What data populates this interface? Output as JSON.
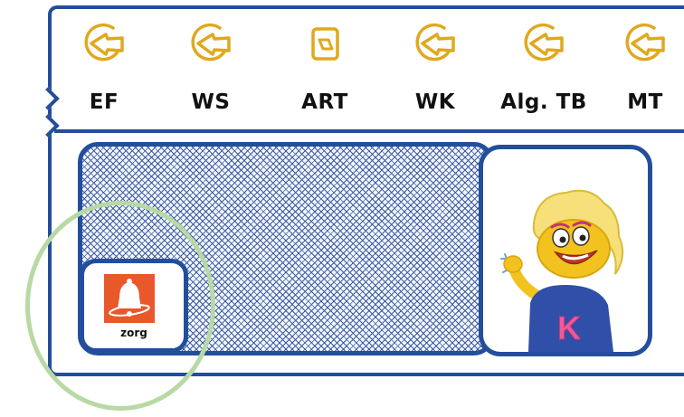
{
  "colors": {
    "frame": "#234e9c",
    "icon_stroke": "#e0a81e",
    "zorg_orange": "#e8582a",
    "highlight": "#b8d9a4"
  },
  "toolbar": {
    "items": [
      {
        "label": "EF",
        "icon": "chevron-circle-icon"
      },
      {
        "label": "WS",
        "icon": "chevron-circle-icon"
      },
      {
        "label": "ART",
        "icon": "square-document-icon"
      },
      {
        "label": "WK",
        "icon": "chevron-circle-icon"
      },
      {
        "label": "Alg. TB",
        "icon": "chevron-circle-icon"
      },
      {
        "label": "MT",
        "icon": "chevron-circle-icon"
      }
    ]
  },
  "zorg": {
    "label": "zorg",
    "icon": "bell-icon"
  },
  "mascot": {
    "letter": "K"
  }
}
